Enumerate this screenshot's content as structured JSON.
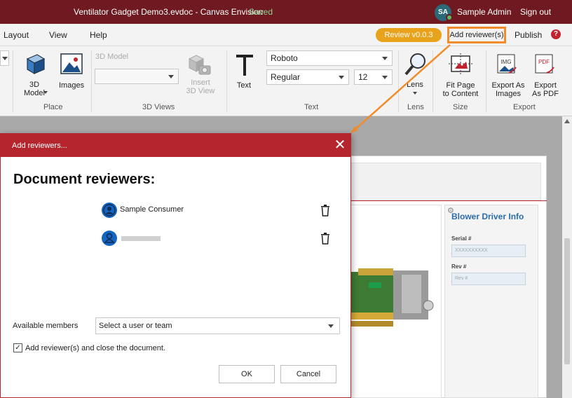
{
  "titlebar": {
    "document_title": "Ventilator Gadget Demo3.evdoc - Canvas Envision",
    "save_status": "Saved",
    "avatar_initials": "SA",
    "user_name": "Sample Admin",
    "sign_out": "Sign out"
  },
  "menu": {
    "items": [
      "Layout",
      "View",
      "Help"
    ],
    "review_badge": "Review v0.0.3",
    "add_reviewers": "Add reviewer(s)",
    "publish": "Publish",
    "help_symbol": "?"
  },
  "ribbon": {
    "place": {
      "label": "Place",
      "model_3d": "3D\nModel",
      "images": "Images"
    },
    "views_3d": {
      "label": "3D Views",
      "model_caption": "3D Model",
      "insert_view": "Insert\n3D View"
    },
    "text": {
      "label": "Text",
      "text_button": "Text",
      "font_family": "Roboto",
      "font_style": "Regular",
      "font_size": "12"
    },
    "lens": {
      "label": "Lens",
      "button": "Lens"
    },
    "size": {
      "label": "Size",
      "fit_page": "Fit Page\nto Content"
    },
    "export": {
      "label": "Export",
      "as_images": "Export As\nImages",
      "as_pdf": "Export\nAs PDF"
    }
  },
  "document": {
    "info_title": "Blower Driver Info",
    "serial_label": "Serial #",
    "serial_placeholder": "XXXXXXXXXX",
    "rev_label": "Rev #",
    "rev_placeholder": "Rev #"
  },
  "dialog": {
    "title": "Add reviewers...",
    "heading": "Document reviewers:",
    "reviewers": [
      {
        "name": "Sample Consumer"
      },
      {
        "name": ""
      }
    ],
    "available_members_label": "Available members",
    "members_select_value": "Select a user or team",
    "close_checkbox_label": "Add reviewer(s) and close the document.",
    "close_checkbox_checked": true,
    "ok": "OK",
    "cancel": "Cancel"
  },
  "colors": {
    "titlebar": "#6e1a20",
    "dialog_header": "#b5252d",
    "review_badge": "#e8a21c",
    "highlight": "#f08c2a",
    "avatar_blue": "#1565c0"
  }
}
